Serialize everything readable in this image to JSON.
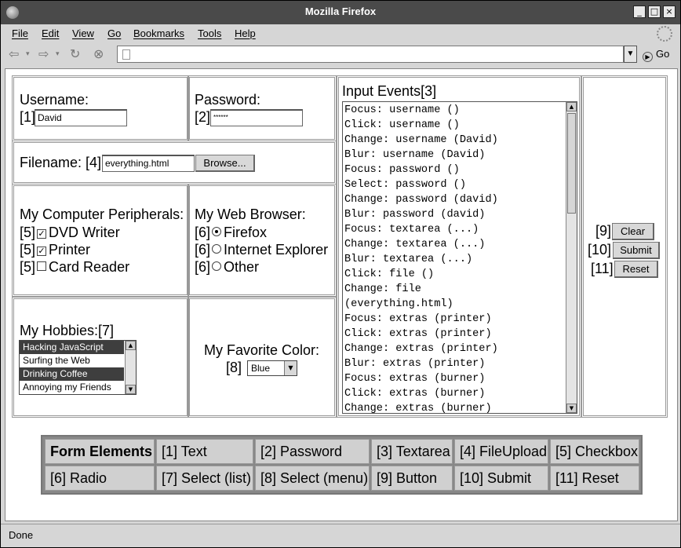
{
  "window": {
    "title": "Mozilla Firefox",
    "controls": [
      "_",
      "□",
      "×"
    ]
  },
  "menu": [
    "File",
    "Edit",
    "View",
    "Go",
    "Bookmarks",
    "Tools",
    "Help"
  ],
  "navbar": {
    "go_label": "Go",
    "url": ""
  },
  "form": {
    "username": {
      "label": "Username:",
      "index": "[1]",
      "value": "David"
    },
    "password": {
      "label": "Password:",
      "index": "[2]",
      "value": "******"
    },
    "filename": {
      "label": "Filename:",
      "index": "[4]",
      "value": "everything.html",
      "browse_label": "Browse..."
    },
    "peripherals": {
      "label": "My Computer Peripherals:",
      "items": [
        {
          "index": "[5]",
          "label": "DVD Writer",
          "checked": true
        },
        {
          "index": "[5]",
          "label": "Printer",
          "checked": true
        },
        {
          "index": "[5]",
          "label": "Card Reader",
          "checked": false
        }
      ]
    },
    "browser": {
      "label": "My Web Browser:",
      "items": [
        {
          "index": "[6]",
          "label": "Firefox",
          "selected": true
        },
        {
          "index": "[6]",
          "label": "Internet Explorer",
          "selected": false
        },
        {
          "index": "[6]",
          "label": "Other",
          "selected": false
        }
      ]
    },
    "hobbies": {
      "label": "My Hobbies:[7]",
      "options": [
        {
          "label": "Hacking JavaScript",
          "selected": true
        },
        {
          "label": "Surfing the Web",
          "selected": false
        },
        {
          "label": "Drinking Coffee",
          "selected": true
        },
        {
          "label": "Annoying my Friends",
          "selected": false
        }
      ]
    },
    "color": {
      "label": "My Favorite Color:",
      "index": "[8]",
      "value": "Blue"
    },
    "events": {
      "label": "Input Events[3]",
      "lines": [
        "Focus: username ()",
        "Click: username ()",
        "Change: username (David)",
        "Blur: username (David)",
        "Focus: password ()",
        "Select: password ()",
        "Change: password (david)",
        "Blur: password (david)",
        "Focus: textarea (...)",
        "Change: textarea (...)",
        "Blur: textarea (...)",
        "Click: file ()",
        "Change: file",
        "(everything.html)",
        "Focus: extras (printer)",
        "Click: extras (printer)",
        "Change: extras (printer)",
        "Blur: extras (printer)",
        "Focus: extras (burner)",
        "Click: extras (burner)",
        "Change: extras (burner)"
      ]
    },
    "buttons": {
      "clear": {
        "index": "[9]",
        "label": "Clear"
      },
      "submit": {
        "index": "[10]",
        "label": "Submit"
      },
      "reset": {
        "index": "[11]",
        "label": "Reset"
      }
    }
  },
  "legend": {
    "row1": [
      "Form Elements",
      "[1] Text",
      "[2] Password",
      "[3] Textarea",
      "[4] FileUpload",
      "[5] Checkbox"
    ],
    "row2": [
      "[6] Radio",
      "[7] Select (list)",
      "[8] Select (menu)",
      "[9] Button",
      "[10] Submit",
      "[11] Reset"
    ]
  },
  "status": "Done"
}
